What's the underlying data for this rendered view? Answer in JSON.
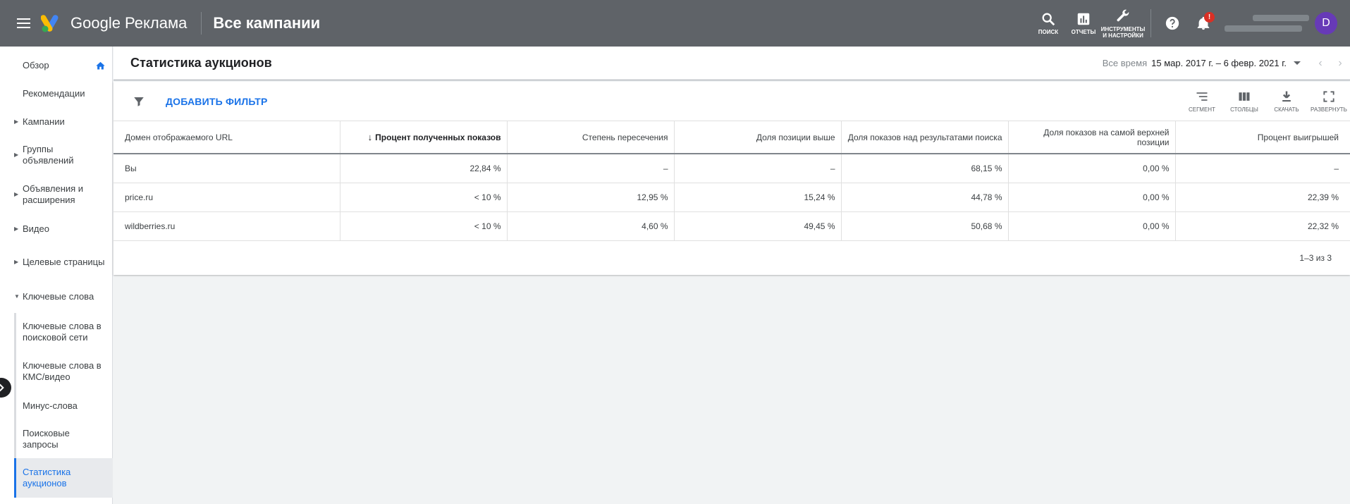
{
  "header": {
    "brand": "Google Реклама",
    "page_title": "Все кампании",
    "tools": [
      {
        "label": "ПОИСК",
        "icon": "search-icon"
      },
      {
        "label": "ОТЧЕТЫ",
        "icon": "reports-icon"
      },
      {
        "label": "ИНСТРУМЕНТЫ И НАСТРОЙКИ",
        "icon": "wrench-icon"
      }
    ],
    "notification_badge": "!",
    "avatar_letter": "D"
  },
  "sidebar": {
    "items": [
      {
        "label": "Обзор"
      },
      {
        "label": "Рекомендации"
      },
      {
        "label": "Кампании"
      },
      {
        "label": "Группы объявлений"
      },
      {
        "label": "Объявления и расширения"
      },
      {
        "label": "Видео"
      },
      {
        "label": "Целевые страницы"
      },
      {
        "label": "Ключевые слова"
      }
    ],
    "sub_items": [
      {
        "label": "Ключевые слова в поисковой сети"
      },
      {
        "label": "Ключевые слова в КМС/видео"
      },
      {
        "label": "Минус-слова"
      },
      {
        "label": "Поисковые запросы"
      },
      {
        "label": "Статистика аукционов"
      }
    ]
  },
  "main": {
    "title": "Статистика аукционов",
    "date_preset": "Все время",
    "date_range": "15 мар. 2017 г. – 6 февр. 2021 г.",
    "add_filter": "ДОБАВИТЬ ФИЛЬТР",
    "toolbar": [
      {
        "label": "СЕГМЕНТ",
        "icon": "segment-icon"
      },
      {
        "label": "СТОЛБЦЫ",
        "icon": "columns-icon"
      },
      {
        "label": "СКАЧАТЬ",
        "icon": "download-icon"
      },
      {
        "label": "РАЗВЕРНУТЬ",
        "icon": "fullscreen-icon"
      }
    ],
    "columns": [
      "Домен отображаемого URL",
      "Процент полученных показов",
      "Степень пересечения",
      "Доля позиции выше",
      "Доля показов над результатами поиска",
      "Доля показов на самой верхней позиции",
      "Процент выигрышей"
    ],
    "rows": [
      [
        "Вы",
        "22,84 %",
        "–",
        "–",
        "68,15 %",
        "0,00 %",
        "–"
      ],
      [
        "price.ru",
        "< 10 %",
        "12,95 %",
        "15,24 %",
        "44,78 %",
        "0,00 %",
        "22,39 %"
      ],
      [
        "wildberries.ru",
        "< 10 %",
        "4,60 %",
        "49,45 %",
        "50,68 %",
        "0,00 %",
        "22,32 %"
      ]
    ],
    "pager": "1–3 из 3"
  },
  "colors": {
    "topbar": "#5f6368",
    "accent": "#1a73e8",
    "avatar": "#673ab7",
    "badge": "#d93025"
  }
}
